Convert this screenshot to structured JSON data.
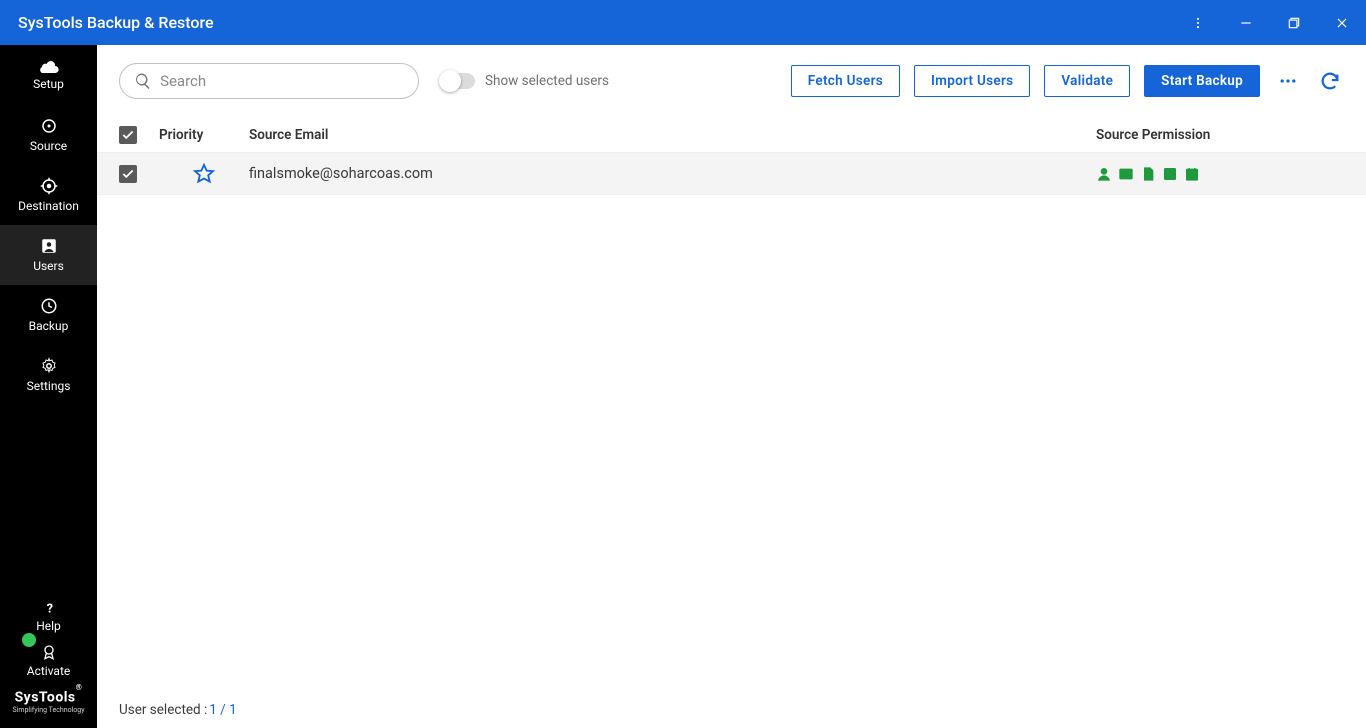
{
  "titlebar": {
    "title": "SysTools Backup & Restore"
  },
  "sidebar": {
    "items": [
      {
        "label": "Setup"
      },
      {
        "label": "Source"
      },
      {
        "label": "Destination"
      },
      {
        "label": "Users"
      },
      {
        "label": "Backup"
      },
      {
        "label": "Settings"
      }
    ],
    "bottom": [
      {
        "label": "Help"
      },
      {
        "label": "Activate"
      }
    ],
    "brand": {
      "name": "SysTools",
      "tagline": "Simplifying Technology"
    }
  },
  "toolbar": {
    "search_placeholder": "Search",
    "toggle_label": "Show selected users",
    "fetch": "Fetch Users",
    "import": "Import Users",
    "validate": "Validate",
    "start": "Start Backup"
  },
  "table": {
    "headers": {
      "priority": "Priority",
      "source_email": "Source Email",
      "source_permission": "Source Permission"
    },
    "rows": [
      {
        "email": "finalsmoke@soharcoas.com"
      }
    ]
  },
  "status": {
    "label": "User selected : ",
    "value": "1 / 1"
  }
}
